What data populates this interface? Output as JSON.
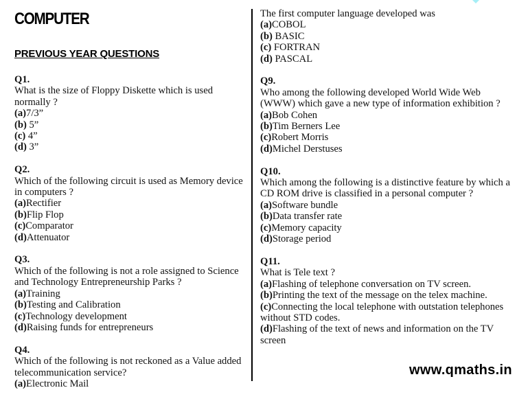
{
  "header": {
    "title": "COMPUTER",
    "subtitle": "PREVIOUS YEAR QUESTIONS"
  },
  "left_column": {
    "questions": [
      {
        "number": "Q1.",
        "text": "What is the size of Floppy Diskette which is used normally ?",
        "options": [
          {
            "letter": "(a)",
            "text": "7/3”"
          },
          {
            "letter": "(b)",
            "text": " 5”"
          },
          {
            "letter": "(c)",
            "text": " 4”"
          },
          {
            "letter": "(d)",
            "text": " 3”"
          }
        ]
      },
      {
        "number": "Q2.",
        "text": "Which of the following circuit is used as Memory device in computers ?",
        "options": [
          {
            "letter": "(a)",
            "text": "Rectifier"
          },
          {
            "letter": "(b)",
            "text": "Flip Flop"
          },
          {
            "letter": "(c)",
            "text": "Comparator"
          },
          {
            "letter": "(d)",
            "text": "Attenuator"
          }
        ]
      },
      {
        "number": "Q3.",
        "text": "Which of the following is not a role assigned to Science and Technology Entrepreneurship Parks ?",
        "options": [
          {
            "letter": "(a)",
            "text": "Training"
          },
          {
            "letter": "(b)",
            "text": "Testing and Calibration"
          },
          {
            "letter": "(c)",
            "text": "Technology development"
          },
          {
            "letter": "(d)",
            "text": "Raising funds for entrepreneurs"
          }
        ]
      },
      {
        "number": "Q4.",
        "text": " Which of the following is not reckoned as a Value added telecommunication service?",
        "options": [
          {
            "letter": "(a)",
            "text": "Electronic Mail"
          }
        ]
      }
    ]
  },
  "right_column": {
    "questions": [
      {
        "number": "",
        "text": "The first computer language developed was",
        "options": [
          {
            "letter": "(a)",
            "text": "COBOL"
          },
          {
            "letter": "(b)",
            "text": " BASIC"
          },
          {
            "letter": "(c)",
            "text": " FORTRAN"
          },
          {
            "letter": "(d)",
            "text": " PASCAL"
          }
        ]
      },
      {
        "number": "Q9.",
        "text": "Who among the following developed World Wide Web (WWW) which gave a new type of information exhibition ?",
        "options": [
          {
            "letter": "(a)",
            "text": "Bob Cohen"
          },
          {
            "letter": "(b)",
            "text": "Tim Berners Lee"
          },
          {
            "letter": "(c)",
            "text": "Robert Morris"
          },
          {
            "letter": "(d)",
            "text": "Michel Derstuses"
          }
        ]
      },
      {
        "number": "Q10.",
        "text": "Which among the following is a distinctive feature by which a CD ROM drive is classified in a personal computer ?",
        "options": [
          {
            "letter": "(a)",
            "text": "Software bundle"
          },
          {
            "letter": "(b)",
            "text": "Data transfer rate"
          },
          {
            "letter": "(c)",
            "text": "Memory capacity"
          },
          {
            "letter": "(d)",
            "text": "Storage period"
          }
        ]
      },
      {
        "number": "Q11.",
        "text": "What is Tele text ?",
        "options": [
          {
            "letter": "(a)",
            "text": "Flashing of telephone conversation on TV screen."
          },
          {
            "letter": "(b)",
            "text": "Printing the text of the message on the telex machine."
          },
          {
            "letter": "(c)",
            "text": "Connecting the local telephone with outstation telephones without STD codes."
          },
          {
            "letter": "(d)",
            "text": "Flashing of the text of news and information on the TV screen"
          }
        ]
      }
    ]
  },
  "footer": {
    "website": "www.qmaths.in"
  },
  "colors": {
    "text": "#111111",
    "divider": "#000000",
    "decoration": "#a6eef6"
  }
}
